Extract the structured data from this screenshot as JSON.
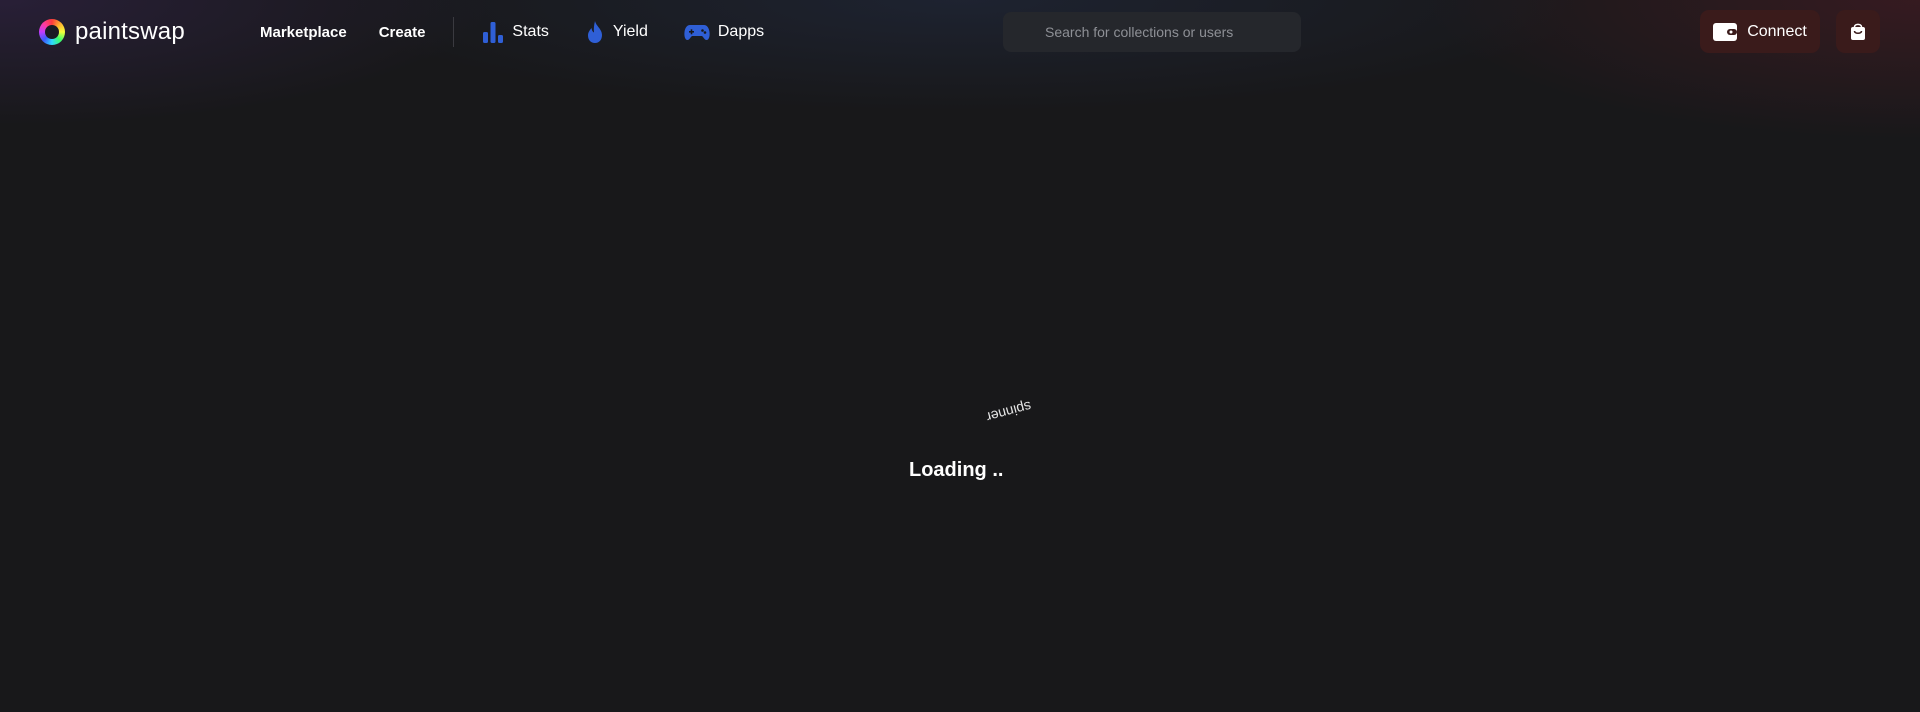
{
  "brand": {
    "name": "paintswap",
    "logo_icon": "paintswap-ring-icon"
  },
  "nav": {
    "marketplace": "Marketplace",
    "create": "Create",
    "stats": "Stats",
    "yield": "Yield",
    "dapps": "Dapps"
  },
  "search": {
    "placeholder": "Search for collections or users"
  },
  "actions": {
    "connect_label": "Connect"
  },
  "main": {
    "spinner_alt": "spinner",
    "loading_text": "Loading .."
  },
  "colors": {
    "background": "#18181a",
    "accent_blue": "#2f5fd6",
    "button_bg": "#3a1b1b",
    "search_bg": "#25272c"
  }
}
